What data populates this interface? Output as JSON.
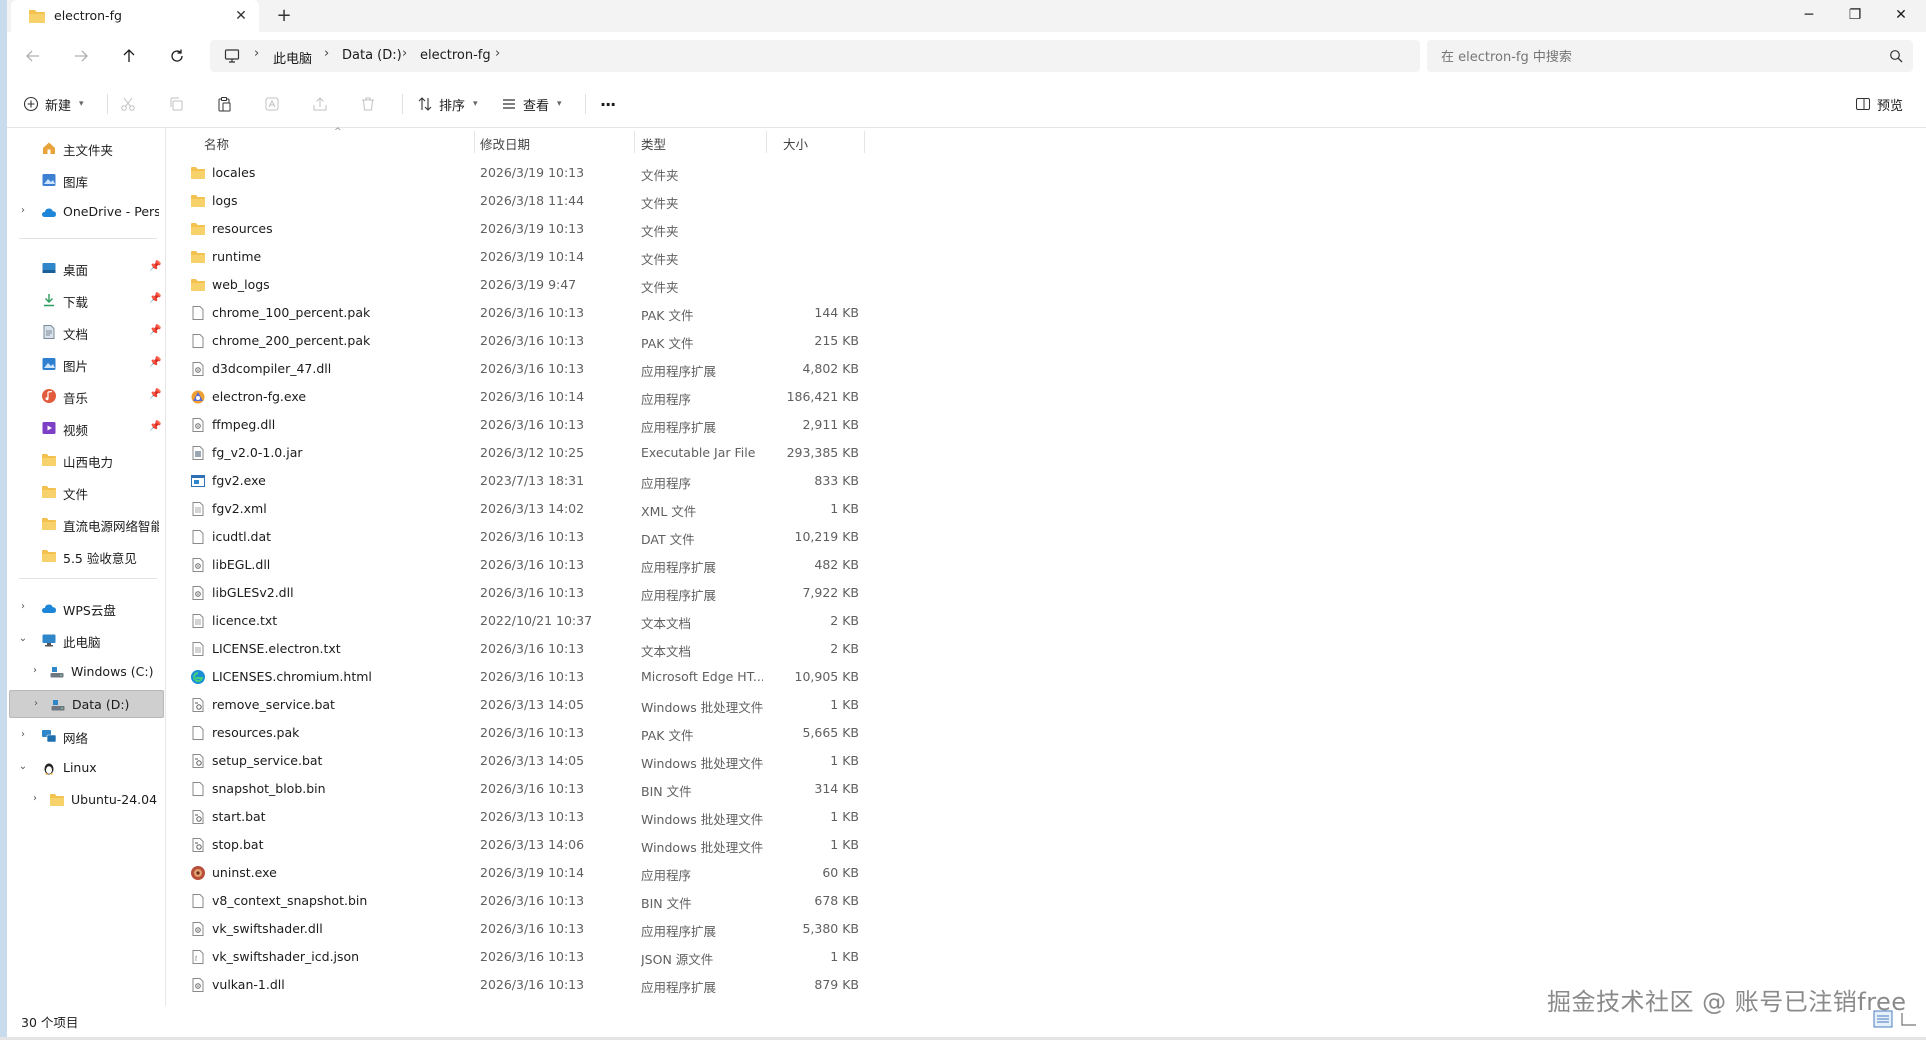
{
  "tab": {
    "title": "electron-fg",
    "close": "✕",
    "new": "+"
  },
  "window_controls": {
    "minimize": "─",
    "maximize": "❐",
    "close": "✕"
  },
  "breadcrumb": {
    "items": [
      "此电脑",
      "Data (D:)",
      "electron-fg"
    ],
    "separator": "›"
  },
  "search": {
    "placeholder": "在 electron-fg 中搜索"
  },
  "toolbar": {
    "new_label": "新建",
    "sort_label": "排序",
    "view_label": "查看",
    "more_label": "···",
    "preview_label": "预览"
  },
  "sidebar": {
    "top": [
      {
        "label": "主文件夹",
        "icon": "home-icon"
      },
      {
        "label": "图库",
        "icon": "gallery-icon"
      },
      {
        "label": "OneDrive - Perso",
        "icon": "cloud-icon"
      }
    ],
    "quick": [
      {
        "label": "桌面",
        "icon": "desktop-icon",
        "color": "#2f86c9"
      },
      {
        "label": "下载",
        "icon": "download-icon",
        "color": "#2b9c5a"
      },
      {
        "label": "文档",
        "icon": "document-icon",
        "color": "#7a8a9a"
      },
      {
        "label": "图片",
        "icon": "pictures-icon",
        "color": "#2f7fd1"
      },
      {
        "label": "音乐",
        "icon": "music-icon",
        "color": "#e25b3c"
      },
      {
        "label": "视频",
        "icon": "video-icon",
        "color": "#7d3fc6"
      },
      {
        "label": "山西电力",
        "icon": "folder-icon"
      },
      {
        "label": "文件",
        "icon": "folder-icon"
      },
      {
        "label": "直流电源网络智能",
        "icon": "folder-icon"
      },
      {
        "label": "5.5 验收意见",
        "icon": "folder-icon"
      }
    ],
    "tree": [
      {
        "label": "WPS云盘",
        "icon": "cloud-icon"
      },
      {
        "label": "此电脑",
        "icon": "computer-icon"
      },
      {
        "label": "Windows (C:)",
        "icon": "drive-icon"
      },
      {
        "label": "Data (D:)",
        "icon": "drive-icon"
      },
      {
        "label": "网络",
        "icon": "network-icon"
      },
      {
        "label": "Linux",
        "icon": "linux-icon"
      },
      {
        "label": "Ubuntu-24.04",
        "icon": "folder-icon"
      }
    ]
  },
  "columns": {
    "name": "名称",
    "date": "修改日期",
    "type": "类型",
    "size": "大小"
  },
  "files": [
    {
      "name": "locales",
      "date": "2026/3/19 10:13",
      "type": "文件夹",
      "size": "",
      "icon": "folder"
    },
    {
      "name": "logs",
      "date": "2026/3/18 11:44",
      "type": "文件夹",
      "size": "",
      "icon": "folder"
    },
    {
      "name": "resources",
      "date": "2026/3/19 10:13",
      "type": "文件夹",
      "size": "",
      "icon": "folder"
    },
    {
      "name": "runtime",
      "date": "2026/3/19 10:14",
      "type": "文件夹",
      "size": "",
      "icon": "folder"
    },
    {
      "name": "web_logs",
      "date": "2026/3/19 9:47",
      "type": "文件夹",
      "size": "",
      "icon": "folder"
    },
    {
      "name": "chrome_100_percent.pak",
      "date": "2026/3/16 10:13",
      "type": "PAK 文件",
      "size": "144 KB",
      "icon": "file"
    },
    {
      "name": "chrome_200_percent.pak",
      "date": "2026/3/16 10:13",
      "type": "PAK 文件",
      "size": "215 KB",
      "icon": "file"
    },
    {
      "name": "d3dcompiler_47.dll",
      "date": "2026/3/16 10:13",
      "type": "应用程序扩展",
      "size": "4,802 KB",
      "icon": "dll"
    },
    {
      "name": "electron-fg.exe",
      "date": "2026/3/16 10:14",
      "type": "应用程序",
      "size": "186,421 KB",
      "icon": "app"
    },
    {
      "name": "ffmpeg.dll",
      "date": "2026/3/16 10:13",
      "type": "应用程序扩展",
      "size": "2,911 KB",
      "icon": "dll"
    },
    {
      "name": "fg_v2.0-1.0.jar",
      "date": "2026/3/12 10:25",
      "type": "Executable Jar File",
      "size": "293,385 KB",
      "icon": "jar"
    },
    {
      "name": "fgv2.exe",
      "date": "2023/7/13 18:31",
      "type": "应用程序",
      "size": "833 KB",
      "icon": "exe"
    },
    {
      "name": "fgv2.xml",
      "date": "2026/3/13 14:02",
      "type": "XML 文件",
      "size": "1 KB",
      "icon": "text"
    },
    {
      "name": "icudtl.dat",
      "date": "2026/3/16 10:13",
      "type": "DAT 文件",
      "size": "10,219 KB",
      "icon": "file"
    },
    {
      "name": "libEGL.dll",
      "date": "2026/3/16 10:13",
      "type": "应用程序扩展",
      "size": "482 KB",
      "icon": "dll"
    },
    {
      "name": "libGLESv2.dll",
      "date": "2026/3/16 10:13",
      "type": "应用程序扩展",
      "size": "7,922 KB",
      "icon": "dll"
    },
    {
      "name": "licence.txt",
      "date": "2022/10/21 10:37",
      "type": "文本文档",
      "size": "2 KB",
      "icon": "text"
    },
    {
      "name": "LICENSE.electron.txt",
      "date": "2026/3/16 10:13",
      "type": "文本文档",
      "size": "2 KB",
      "icon": "text"
    },
    {
      "name": "LICENSES.chromium.html",
      "date": "2026/3/16 10:13",
      "type": "Microsoft Edge HT...",
      "size": "10,905 KB",
      "icon": "edge"
    },
    {
      "name": "remove_service.bat",
      "date": "2026/3/13 14:05",
      "type": "Windows 批处理文件",
      "size": "1 KB",
      "icon": "bat"
    },
    {
      "name": "resources.pak",
      "date": "2026/3/16 10:13",
      "type": "PAK 文件",
      "size": "5,665 KB",
      "icon": "file"
    },
    {
      "name": "setup_service.bat",
      "date": "2026/3/13 14:05",
      "type": "Windows 批处理文件",
      "size": "1 KB",
      "icon": "bat"
    },
    {
      "name": "snapshot_blob.bin",
      "date": "2026/3/16 10:13",
      "type": "BIN 文件",
      "size": "314 KB",
      "icon": "file"
    },
    {
      "name": "start.bat",
      "date": "2026/3/13 10:13",
      "type": "Windows 批处理文件",
      "size": "1 KB",
      "icon": "bat"
    },
    {
      "name": "stop.bat",
      "date": "2026/3/13 14:06",
      "type": "Windows 批处理文件",
      "size": "1 KB",
      "icon": "bat"
    },
    {
      "name": "uninst.exe",
      "date": "2026/3/19 10:14",
      "type": "应用程序",
      "size": "60 KB",
      "icon": "uninst"
    },
    {
      "name": "v8_context_snapshot.bin",
      "date": "2026/3/16 10:13",
      "type": "BIN 文件",
      "size": "678 KB",
      "icon": "file"
    },
    {
      "name": "vk_swiftshader.dll",
      "date": "2026/3/16 10:13",
      "type": "应用程序扩展",
      "size": "5,380 KB",
      "icon": "dll"
    },
    {
      "name": "vk_swiftshader_icd.json",
      "date": "2026/3/16 10:13",
      "type": "JSON 源文件",
      "size": "1 KB",
      "icon": "json"
    },
    {
      "name": "vulkan-1.dll",
      "date": "2026/3/16 10:13",
      "type": "应用程序扩展",
      "size": "879 KB",
      "icon": "dll"
    }
  ],
  "status": {
    "count": "30 个项目"
  },
  "watermark": "掘金技术社区 @ 账号已注销free",
  "colors": {
    "folder": "#f2c14e",
    "accent": "#0067c0",
    "selected": "#cfcfcf"
  }
}
